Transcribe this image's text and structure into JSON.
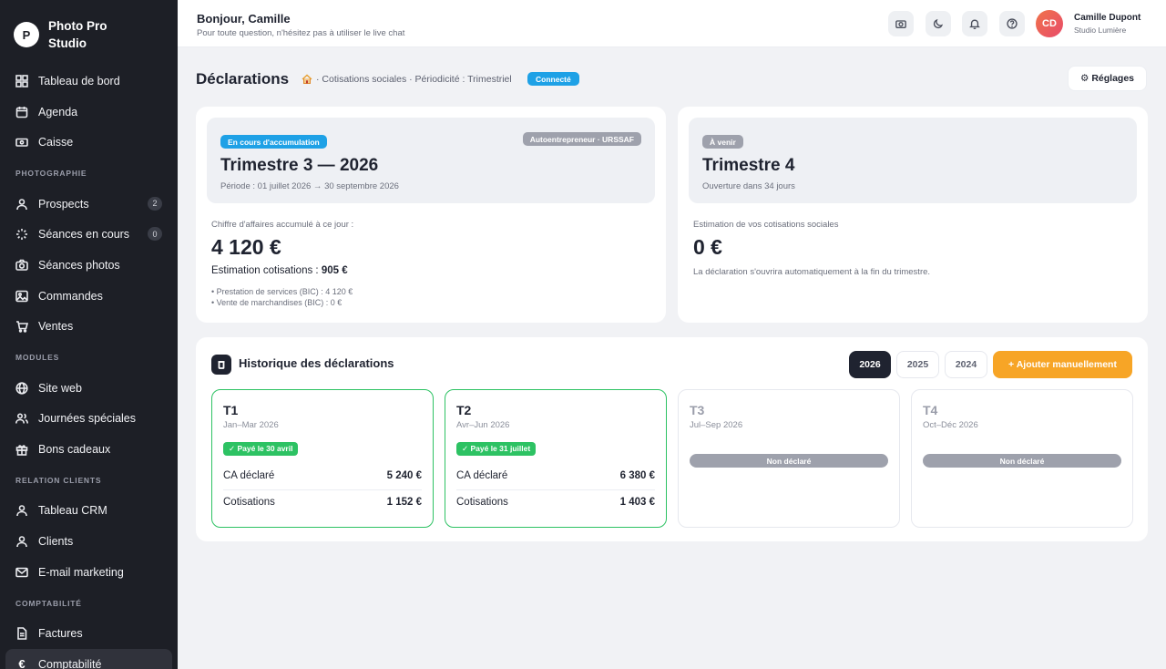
{
  "brand": {
    "logo_letter": "P",
    "name": "Photo Pro Studio"
  },
  "sidebar": {
    "items_main": [
      {
        "label": "Tableau de bord",
        "icon": "dashboard-icon"
      },
      {
        "label": "Agenda",
        "icon": "calendar-icon"
      },
      {
        "label": "Caisse",
        "icon": "cash-icon"
      }
    ],
    "section_photographie": "PHOTOGRAPHIE",
    "items_photo": [
      {
        "label": "Prospects",
        "icon": "user-icon",
        "count": "2"
      },
      {
        "label": "Séances en cours",
        "icon": "loader-icon",
        "count": "0"
      },
      {
        "label": "Séances photos",
        "icon": "camera-icon"
      },
      {
        "label": "Commandes",
        "icon": "image-icon"
      },
      {
        "label": "Ventes",
        "icon": "cart-icon"
      }
    ],
    "section_modules": "MODULES",
    "items_modules": [
      {
        "label": "Site web",
        "icon": "globe-icon"
      },
      {
        "label": "Journées spéciales",
        "icon": "users-icon"
      },
      {
        "label": "Bons cadeaux",
        "icon": "gift-icon"
      }
    ],
    "section_crm": "RELATION CLIENTS",
    "items_crm": [
      {
        "label": "Tableau CRM",
        "icon": "user-icon"
      },
      {
        "label": "Clients",
        "icon": "user-icon"
      },
      {
        "label": "E-mail marketing",
        "icon": "mail-icon"
      }
    ],
    "section_compta": "COMPTABILITÉ",
    "items_compta": [
      {
        "label": "Factures",
        "icon": "file-icon"
      },
      {
        "label": "Comptabilité",
        "icon": "euro-icon",
        "active": true
      }
    ]
  },
  "header": {
    "greeting": "Bonjour, Camille",
    "subtitle": "Pour toute question, n'hésitez pas à utiliser le live chat",
    "user_initials": "CD",
    "user_name": "Camille Dupont",
    "user_studio": "Studio Lumière"
  },
  "page": {
    "title": "Déclarations",
    "breadcrumb": "· Cotisations sociales · Périodicité : Trimestriel",
    "status_badge": "Connecté",
    "settings_label": "⚙ Réglages"
  },
  "current_quarter": {
    "badge": "En cours d'accumulation",
    "regime_badge": "Autoentrepreneur · URSSAF",
    "title": "Trimestre 3 — 2026",
    "period": "Période : 01 juillet 2026 → 30 septembre 2026",
    "ca_label": "Chiffre d'affaires accumulé à ce jour :",
    "ca_amount": "4 120 €",
    "estimation_label": "Estimation cotisations :",
    "estimation_value": "905 €",
    "detail_1": "• Prestation de services (BIC) : 4 120 €",
    "detail_2": "• Vente de marchandises (BIC) : 0 €",
    "colors": {
      "badge": "#1ea1e6",
      "regime": "#9ea1ac"
    }
  },
  "next_quarter": {
    "badge": "À venir",
    "title": "Trimestre 4",
    "opening": "Ouverture dans 34 jours",
    "estimation_label": "Estimation de vos cotisations sociales",
    "amount": "0 €",
    "note": "La déclaration s'ouvrira automatiquement à la fin du trimestre."
  },
  "history": {
    "title": "Historique des déclarations",
    "years": [
      "2026",
      "2025",
      "2024"
    ],
    "selected_year": "2026",
    "add_button": "+ Ajouter manuellement",
    "quarters": [
      {
        "label": "T1",
        "period": "Jan–Mar 2026",
        "status": "✓ Payé le 30 avril",
        "ca_label": "CA déclaré",
        "ca": "5 240 €",
        "cot_label": "Cotisations",
        "cot": "1 152 €"
      },
      {
        "label": "T2",
        "period": "Avr–Jun 2026",
        "status": "✓ Payé le 31 juillet",
        "ca_label": "CA déclaré",
        "ca": "6 380 €",
        "cot_label": "Cotisations",
        "cot": "1 403 €"
      },
      {
        "label": "T3",
        "period": "Jul–Sep 2026",
        "status": "Non déclaré"
      },
      {
        "label": "T4",
        "period": "Oct–Déc 2026",
        "status": "Non déclaré"
      }
    ]
  }
}
